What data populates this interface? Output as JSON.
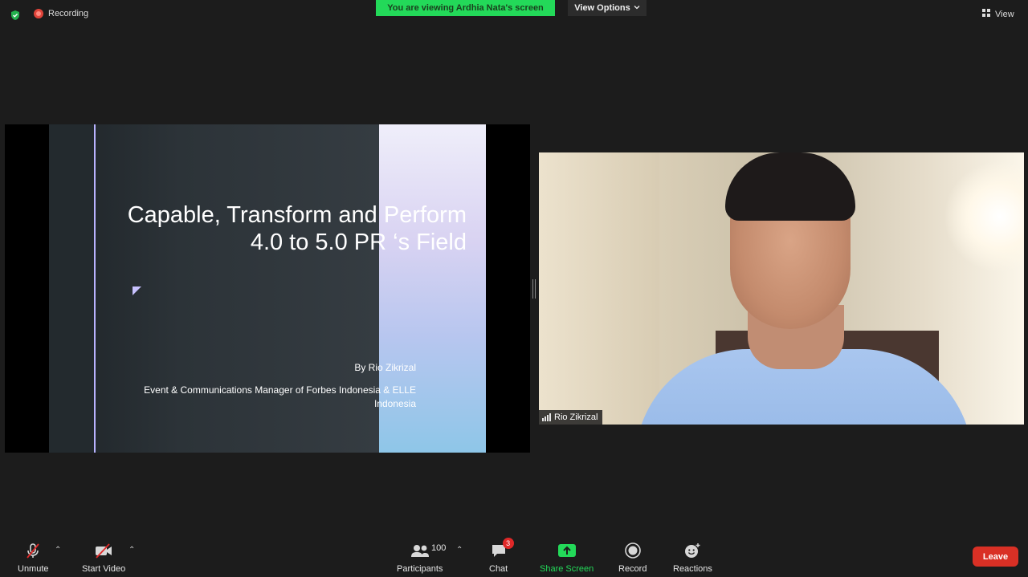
{
  "top": {
    "recording_label": "Recording",
    "viewing_banner": "You are viewing Ardhia Nata's screen",
    "view_options_label": "View Options",
    "view_label": "View"
  },
  "slide": {
    "title_line1": "Capable, Transform and Perform",
    "title_line2": "4.0 to 5.0 PR ‘s Field",
    "by_line": "By Rio Zikrizal",
    "role_line1": "Event & Communications Manager of Forbes Indonesia & ELLE",
    "role_line2": "Indonesia"
  },
  "video": {
    "participant_name": "Rio Zikrizal"
  },
  "toolbar": {
    "unmute_label": "Unmute",
    "start_video_label": "Start Video",
    "participants_label": "Participants",
    "participants_count": "100",
    "chat_label": "Chat",
    "chat_badge": "3",
    "share_screen_label": "Share Screen",
    "record_label": "Record",
    "reactions_label": "Reactions",
    "leave_label": "Leave"
  },
  "colors": {
    "banner_green": "#23d959",
    "share_green": "#23d959",
    "leave_red": "#d93025",
    "badge_red": "#e02828"
  }
}
